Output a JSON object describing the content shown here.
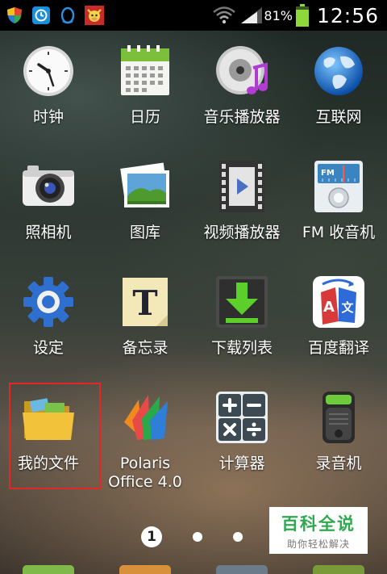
{
  "status_bar": {
    "battery_percent": "81%",
    "time": "12:56",
    "notification_icons": [
      "shield-icon",
      "sync-icon",
      "qq-penguin-icon",
      "cow-icon"
    ]
  },
  "apps": [
    {
      "label": "时钟",
      "icon": "clock-icon"
    },
    {
      "label": "日历",
      "icon": "calendar-icon"
    },
    {
      "label": "音乐播放器",
      "icon": "music-player-icon"
    },
    {
      "label": "互联网",
      "icon": "globe-icon"
    },
    {
      "label": "照相机",
      "icon": "camera-icon"
    },
    {
      "label": "图库",
      "icon": "gallery-icon"
    },
    {
      "label": "视频播放器",
      "icon": "video-player-icon"
    },
    {
      "label": "FM 收音机",
      "icon": "fm-radio-icon"
    },
    {
      "label": "设定",
      "icon": "settings-gear-icon"
    },
    {
      "label": "备忘录",
      "icon": "memo-icon"
    },
    {
      "label": "下载列表",
      "icon": "download-icon"
    },
    {
      "label": "百度翻译",
      "icon": "translate-icon"
    },
    {
      "label": "我的文件",
      "icon": "folder-icon"
    },
    {
      "label": "Polaris\nOffice 4.0",
      "icon": "polaris-office-icon"
    },
    {
      "label": "计算器",
      "icon": "calculator-icon"
    },
    {
      "label": "录音机",
      "icon": "voice-recorder-icon"
    }
  ],
  "page_indicator": {
    "current": "1",
    "total": 3
  },
  "watermark": {
    "title": "百科全说",
    "subtitle": "助你轻松解决"
  },
  "colors": {
    "highlight": "#e32727",
    "watermark_green": "#2fa84f",
    "battery_green": "#8ed83a"
  }
}
